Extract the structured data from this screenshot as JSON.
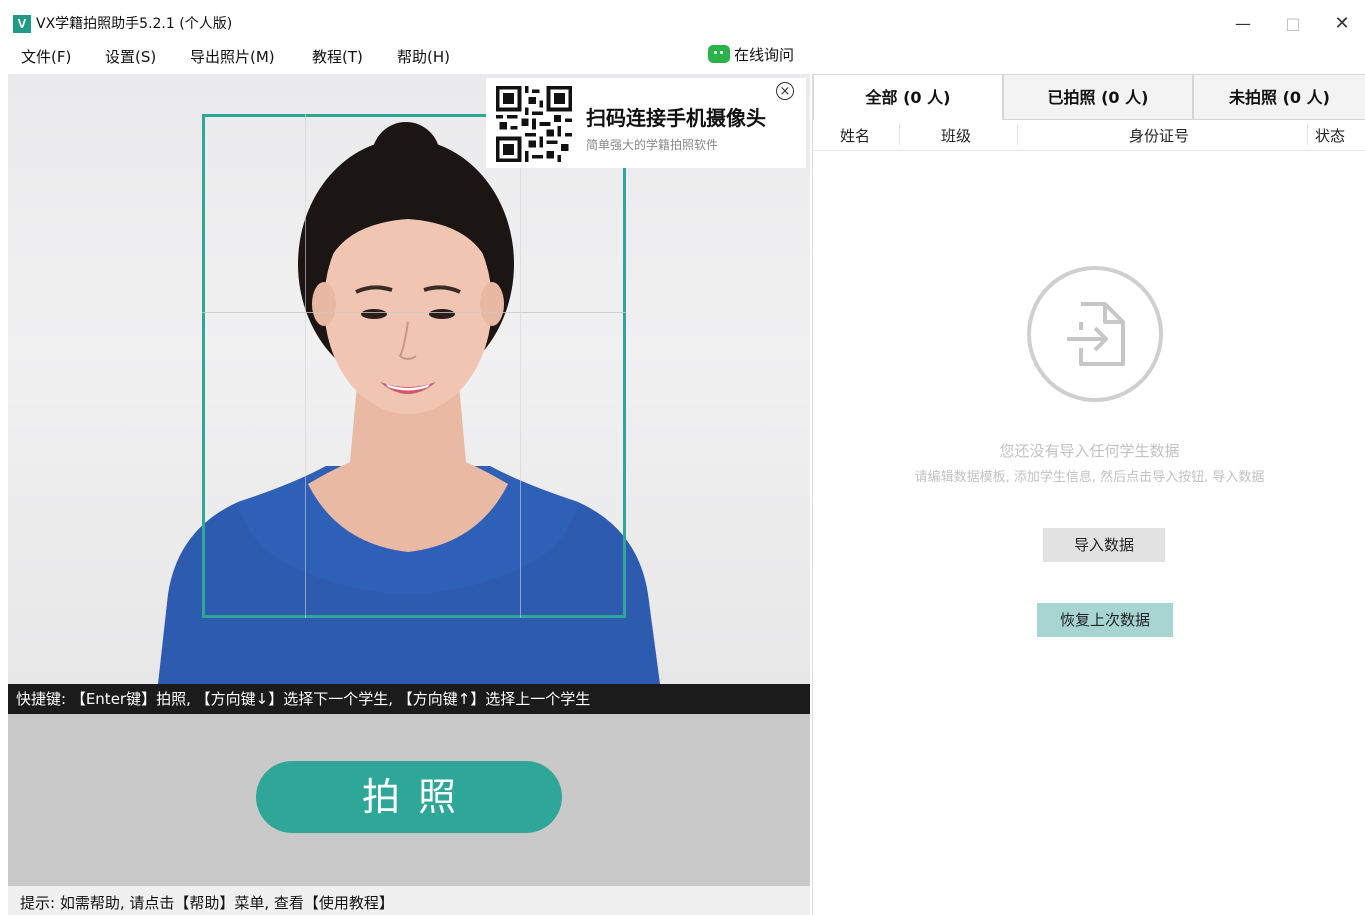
{
  "window": {
    "logo_letter": "V",
    "title": "VX学籍拍照助手5.2.1 (个人版)",
    "minimize": "—",
    "maximize": "□",
    "close": "✕"
  },
  "menu": {
    "items": [
      {
        "label": "文件(F)"
      },
      {
        "label": "设置(S)"
      },
      {
        "label": "导出照片(M)"
      },
      {
        "label": "教程(T)"
      },
      {
        "label": "帮助(H)"
      }
    ],
    "online_ask": "在线询问",
    "online_ask_icon": "wechat-icon"
  },
  "camera": {
    "frame_color": "#2ea796",
    "qr_popup": {
      "title": "扫码连接手机摄像头",
      "subtitle": "简单强大的学籍拍照软件",
      "close": "×"
    },
    "shortcut_hint": "快捷键: 【Enter键】拍照, 【方向键↓】选择下一个学生, 【方向键↑】选择上一个学生"
  },
  "shoot_button": {
    "label": "拍照",
    "color": "#2ea799"
  },
  "status_bar": {
    "text": "提示: 如需帮助, 请点击【帮助】菜单, 查看【使用教程】"
  },
  "right_panel": {
    "tabs": [
      {
        "label": "全部 (0 人)",
        "active": true
      },
      {
        "label": "已拍照 (0 人)",
        "active": false
      },
      {
        "label": "未拍照 (0 人)",
        "active": false
      }
    ],
    "columns": [
      "姓名",
      "班级",
      "身份证号",
      "状态"
    ],
    "empty": {
      "icon": "import-file-icon",
      "line1": "您还没有导入任何学生数据",
      "line2": "请编辑数据模板, 添加学生信息, 然后点击导入按钮, 导入数据"
    },
    "import_button": "导入数据",
    "restore_button": "恢复上次数据"
  }
}
